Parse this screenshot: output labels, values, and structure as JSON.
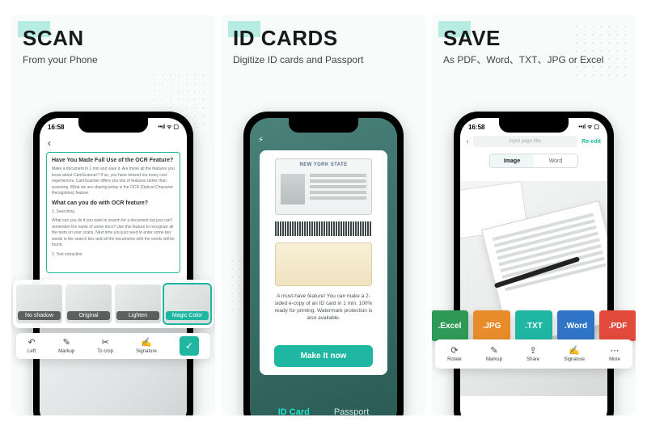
{
  "status": {
    "time": "16:58",
    "carrier_icons": "••ıl ᯤ ▢"
  },
  "panel1": {
    "title": "SCAN",
    "subtitle": "From your Phone",
    "doc": {
      "h1": "Have You Made Full Use of the OCR Feature?",
      "p1": "Make a document in 1 min and save it. Are these all the features you know about CamScanner? If so, you have missed too many cool experiences. CamScanner offers you lots of features rather than scanning. What we are sharing today is the OCR (Optical Character Recognition) feature.",
      "h2": "What can you do with OCR feature?",
      "s1": "1. Searching",
      "p2": "What can you do if you want to search for a document but just can't remember the name of some docs? Use this feature to recognize all the texts on your scans. Next time you just need to enter some key words in the search box and all the documents with the words will be found.",
      "s2": "2. Text extraction"
    },
    "filters": {
      "a": "No shadow",
      "b": "Original",
      "c": "Lighten",
      "d": "Magic Color"
    },
    "toolbar": {
      "left": "Left",
      "markup": "Markup",
      "tocrop": "To crop",
      "signature": "Signature",
      "ok": "✓"
    }
  },
  "panel2": {
    "title": "ID CARDS",
    "subtitle": "Digitize ID cards and Passport",
    "idstate": "NEW YORK STATE",
    "caption": "A must-have feature! You can make a 2-sided e-copy of an ID card in 1 min. 100% ready for printing. Watermark protection is also available.",
    "make": "Make It now",
    "tabs": {
      "id": "ID Card",
      "pp": "Passport"
    }
  },
  "panel3": {
    "title": "SAVE",
    "subtitle": "As PDF、Word、TXT、JPG or Excel",
    "hint": "Input page title",
    "reedit": "Re-edit",
    "seg": {
      "a": "Image",
      "b": "Word"
    },
    "files": {
      "excel": {
        "label": ".Excel",
        "color": "#2f9a57"
      },
      "jpg": {
        "label": ".JPG",
        "color": "#e88c2b"
      },
      "txt": {
        "label": ".TXT",
        "color": "#1fb7a2"
      },
      "word": {
        "label": ".Word",
        "color": "#2f74c6"
      },
      "pdf": {
        "label": ".PDF",
        "color": "#e24a3b"
      }
    },
    "toolbar": {
      "rotate": "Rotate",
      "markup": "Markup",
      "share": "Share",
      "signature": "Signature",
      "more": "More"
    }
  }
}
